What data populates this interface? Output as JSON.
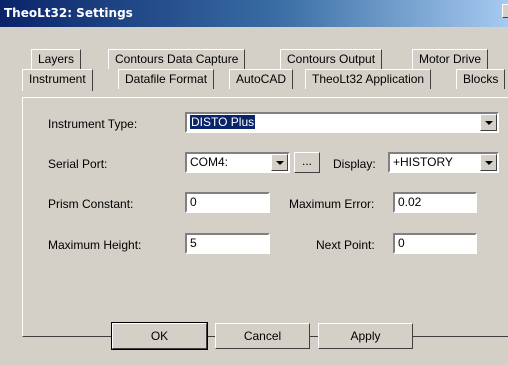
{
  "window": {
    "title": "TheoLt32: Settings"
  },
  "tabs": {
    "row1": [
      "Layers",
      "Contours Data Capture",
      "Contours Output",
      "Motor Drive"
    ],
    "row2": [
      "Instrument",
      "Datafile Format",
      "AutoCAD",
      "TheoLt32 Application",
      "Blocks"
    ]
  },
  "instrument": {
    "instrument_type": {
      "label": "Instrument Type:",
      "value": "DISTO Plus"
    },
    "serial_port": {
      "label": "Serial Port:",
      "value": "COM4:"
    },
    "browse": {
      "label": "..."
    },
    "display": {
      "label": "Display:",
      "value": "+HISTORY"
    },
    "prism_constant": {
      "label": "Prism Constant:",
      "value": "0"
    },
    "maximum_error": {
      "label": "Maximum Error:",
      "value": "0.02"
    },
    "maximum_height": {
      "label": "Maximum Height:",
      "value": "5"
    },
    "next_point": {
      "label": "Next Point:",
      "value": "0"
    }
  },
  "buttons": {
    "ok": "OK",
    "cancel": "Cancel",
    "apply": "Apply"
  }
}
